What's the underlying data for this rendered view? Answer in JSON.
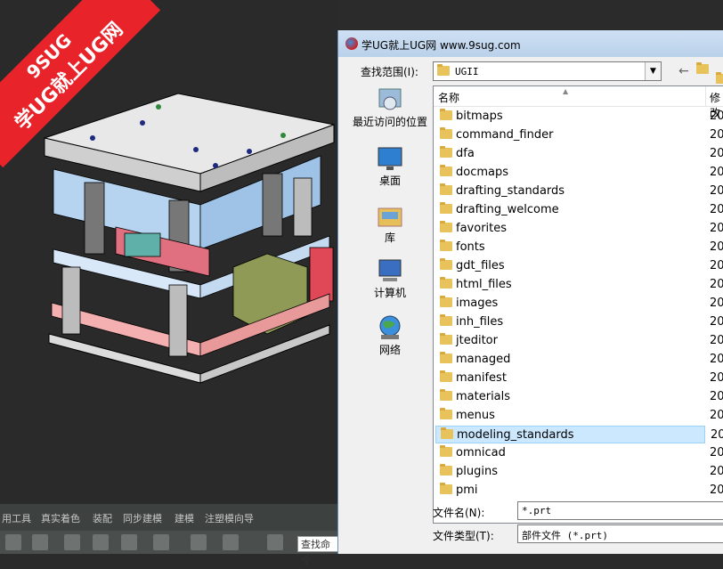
{
  "watermark": {
    "line1": "9SUG",
    "line2": "学UG就上UG网"
  },
  "menubar": {
    "items": [
      "用工具",
      "真实着色",
      "装配",
      "同步建模",
      "建模",
      "注塑模向导"
    ]
  },
  "toolbar": {
    "search_label": "查找命令"
  },
  "dialog": {
    "title": "学UG就上UG网 www.9sug.com",
    "look_in_label": "查找范围(I):",
    "look_in_value": "UGII",
    "places": [
      "最近访问的位置",
      "桌面",
      "库",
      "计算机",
      "网络"
    ],
    "columns": {
      "name": "名称",
      "modified": "修改"
    },
    "folders": [
      "bitmaps",
      "command_finder",
      "dfa",
      "docmaps",
      "drafting_standards",
      "drafting_welcome",
      "favorites",
      "fonts",
      "gdt_files",
      "html_files",
      "images",
      "inh_files",
      "jteditor",
      "managed",
      "manifest",
      "materials",
      "menus",
      "modeling_standards",
      "omnicad",
      "plugins",
      "pmi"
    ],
    "modified_prefix": "20",
    "selected": "modeling_standards",
    "filename_label": "文件名(N):",
    "filename_value": "*.prt",
    "filetype_label": "文件类型(T):",
    "filetype_value": "部件文件 (*.prt)"
  }
}
